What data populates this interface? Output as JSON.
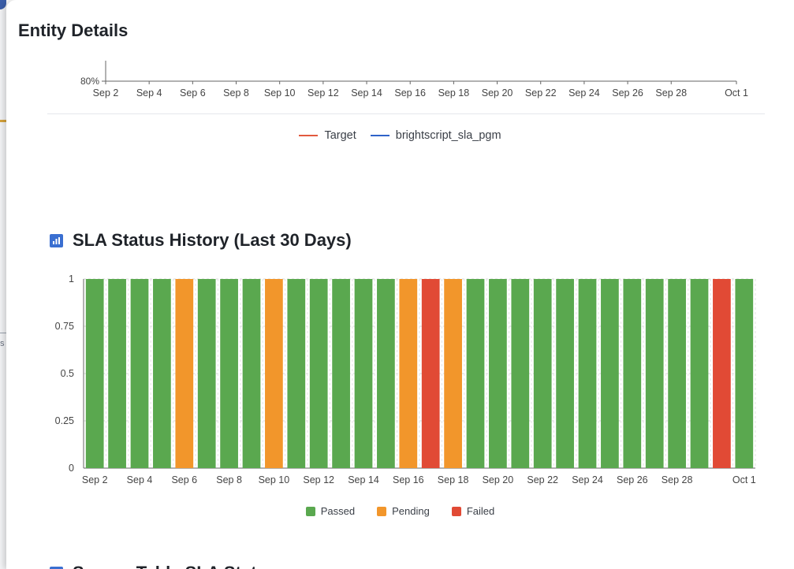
{
  "page": {
    "title": "Entity Details"
  },
  "compliance_chart": {
    "y_tick": "80%",
    "x_ticks": [
      "Sep 2",
      "Sep 4",
      "Sep 6",
      "Sep 8",
      "Sep 10",
      "Sep 12",
      "Sep 14",
      "Sep 16",
      "Sep 18",
      "Sep 20",
      "Sep 22",
      "Sep 24",
      "Sep 26",
      "Sep 28",
      "Oct 1"
    ],
    "legend": [
      {
        "label": "Target",
        "color": "#e25a3e"
      },
      {
        "label": "brightscript_sla_pgm",
        "color": "#2f63c9"
      }
    ]
  },
  "sla_history": {
    "title": "SLA Status History (Last 30 Days)",
    "icon": "bar-chart-icon",
    "accent": "#3a6fd1"
  },
  "chart_data": {
    "type": "bar",
    "title": "SLA Status History (Last 30 Days)",
    "categories": [
      "Sep 2",
      "Sep 3",
      "Sep 4",
      "Sep 5",
      "Sep 6",
      "Sep 7",
      "Sep 8",
      "Sep 9",
      "Sep 10",
      "Sep 11",
      "Sep 12",
      "Sep 13",
      "Sep 14",
      "Sep 15",
      "Sep 16",
      "Sep 17",
      "Sep 18",
      "Sep 19",
      "Sep 20",
      "Sep 21",
      "Sep 22",
      "Sep 23",
      "Sep 24",
      "Sep 25",
      "Sep 26",
      "Sep 27",
      "Sep 28",
      "Sep 29",
      "Sep 30",
      "Oct 1"
    ],
    "x_tick_labels": [
      "Sep 2",
      "Sep 4",
      "Sep 6",
      "Sep 8",
      "Sep 10",
      "Sep 12",
      "Sep 14",
      "Sep 16",
      "Sep 18",
      "Sep 20",
      "Sep 22",
      "Sep 24",
      "Sep 26",
      "Sep 28",
      "Oct 1"
    ],
    "values": [
      1,
      1,
      1,
      1,
      1,
      1,
      1,
      1,
      1,
      1,
      1,
      1,
      1,
      1,
      1,
      1,
      1,
      1,
      1,
      1,
      1,
      1,
      1,
      1,
      1,
      1,
      1,
      1,
      1,
      1
    ],
    "statuses": [
      "Passed",
      "Passed",
      "Passed",
      "Passed",
      "Pending",
      "Passed",
      "Passed",
      "Passed",
      "Pending",
      "Passed",
      "Passed",
      "Passed",
      "Passed",
      "Passed",
      "Pending",
      "Failed",
      "Pending",
      "Passed",
      "Passed",
      "Passed",
      "Passed",
      "Passed",
      "Passed",
      "Passed",
      "Passed",
      "Passed",
      "Passed",
      "Passed",
      "Failed",
      "Passed"
    ],
    "ylim": [
      0,
      1
    ],
    "y_ticks": [
      "0",
      "0.25",
      "0.5",
      "0.75",
      "1"
    ],
    "grid": true,
    "legend_position": "bottom",
    "series": [
      {
        "name": "Passed",
        "color": "#5aa84f"
      },
      {
        "name": "Pending",
        "color": "#f2962b"
      },
      {
        "name": "Failed",
        "color": "#e14a35"
      }
    ]
  },
  "next_section": {
    "title": "Source Table SLA Status"
  }
}
